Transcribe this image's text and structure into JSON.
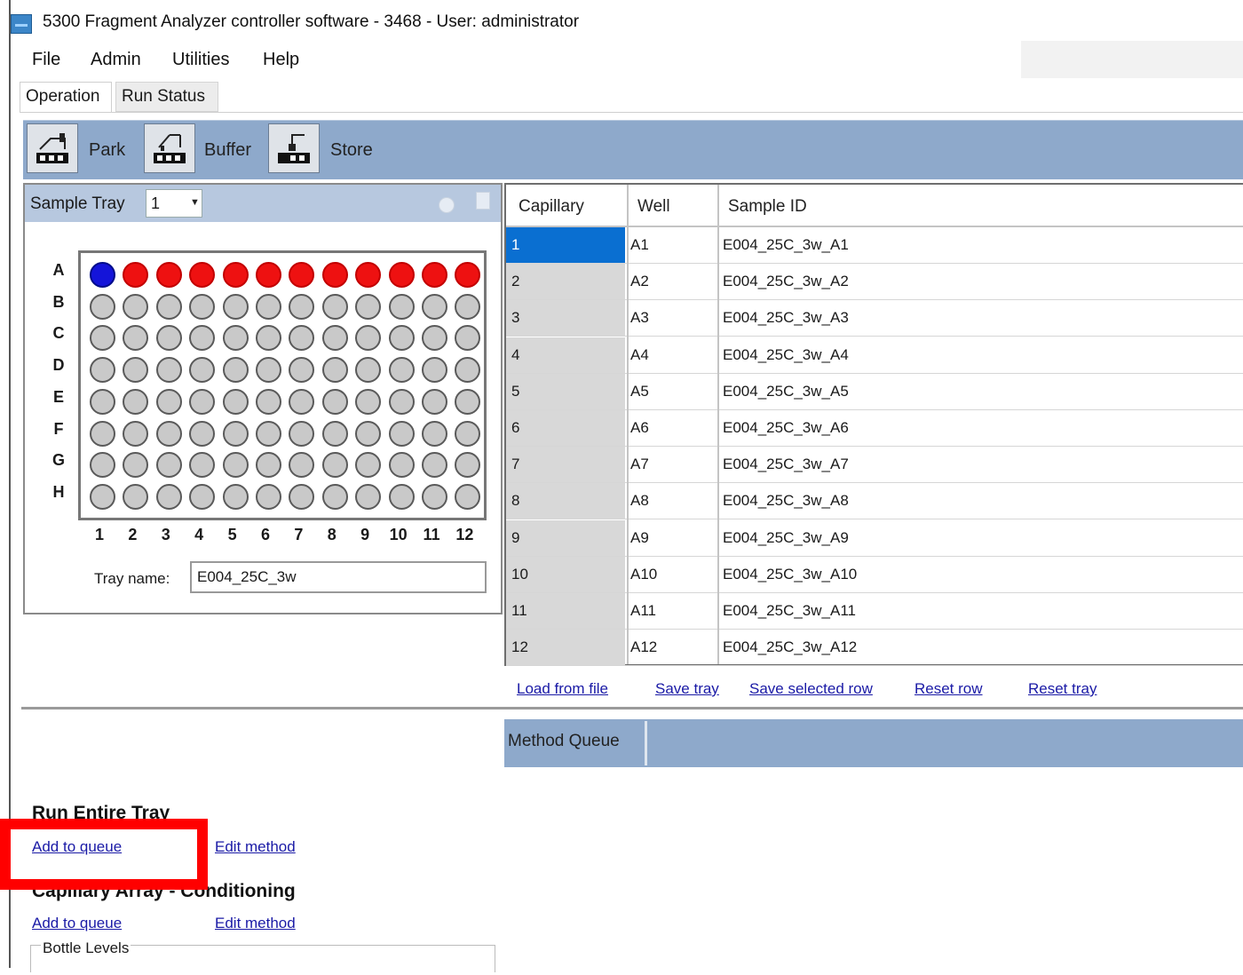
{
  "window": {
    "title": "5300 Fragment Analyzer controller software - 3468 - User: administrator"
  },
  "menu": [
    "File",
    "Admin",
    "Utilities",
    "Help"
  ],
  "tabs": [
    {
      "label": "Operation",
      "active": true
    },
    {
      "label": "Run Status",
      "active": false
    }
  ],
  "toolbar": {
    "park_label": "Park",
    "buffer_label": "Buffer",
    "store_label": "Store"
  },
  "sample_tray": {
    "label": "Sample Tray",
    "selected": "1",
    "rows": [
      "A",
      "B",
      "C",
      "D",
      "E",
      "F",
      "G",
      "H"
    ],
    "columns": [
      "1",
      "2",
      "3",
      "4",
      "5",
      "6",
      "7",
      "8",
      "9",
      "10",
      "11",
      "12"
    ],
    "well_states": {
      "A": [
        "selected",
        "filled",
        "filled",
        "filled",
        "filled",
        "filled",
        "filled",
        "filled",
        "filled",
        "filled",
        "filled",
        "filled"
      ]
    },
    "colors": {
      "selected": "#1414d9",
      "filled": "#ee1111",
      "empty": "#c9c9c9"
    },
    "tray_name_label": "Tray name:",
    "tray_name_value": "E004_25C_3w"
  },
  "sample_grid": {
    "headers": [
      "Capillary",
      "Well",
      "Sample ID"
    ],
    "rows": [
      {
        "capillary": "1",
        "well": "A1",
        "sample_id": "E004_25C_3w_A1",
        "selected": true
      },
      {
        "capillary": "2",
        "well": "A2",
        "sample_id": "E004_25C_3w_A2"
      },
      {
        "capillary": "3",
        "well": "A3",
        "sample_id": "E004_25C_3w_A3"
      },
      {
        "capillary": "4",
        "well": "A4",
        "sample_id": "E004_25C_3w_A4"
      },
      {
        "capillary": "5",
        "well": "A5",
        "sample_id": "E004_25C_3w_A5"
      },
      {
        "capillary": "6",
        "well": "A6",
        "sample_id": "E004_25C_3w_A6"
      },
      {
        "capillary": "7",
        "well": "A7",
        "sample_id": "E004_25C_3w_A7"
      },
      {
        "capillary": "8",
        "well": "A8",
        "sample_id": "E004_25C_3w_A8"
      },
      {
        "capillary": "9",
        "well": "A9",
        "sample_id": "E004_25C_3w_A9"
      },
      {
        "capillary": "10",
        "well": "A10",
        "sample_id": "E004_25C_3w_A10"
      },
      {
        "capillary": "11",
        "well": "A11",
        "sample_id": "E004_25C_3w_A11"
      },
      {
        "capillary": "12",
        "well": "A12",
        "sample_id": "E004_25C_3w_A12"
      }
    ]
  },
  "tray_links": {
    "load_from_file": "Load from file",
    "save_tray": "Save tray",
    "save_selected_row": "Save selected row",
    "reset_row": "Reset row",
    "reset_tray": "Reset tray"
  },
  "method_queue": {
    "label": "Method Queue"
  },
  "run_entire_tray": {
    "title": "Run Entire Tray",
    "add_to_queue": "Add to queue",
    "edit_method": "Edit method"
  },
  "capillary_conditioning": {
    "title": "Capillary Array - Conditioning",
    "add_to_queue": "Add to queue",
    "edit_method": "Edit method"
  },
  "bottle_levels": {
    "label": "Bottle Levels"
  },
  "highlight": {
    "color": "#ff0000",
    "target": "Add to queue"
  }
}
